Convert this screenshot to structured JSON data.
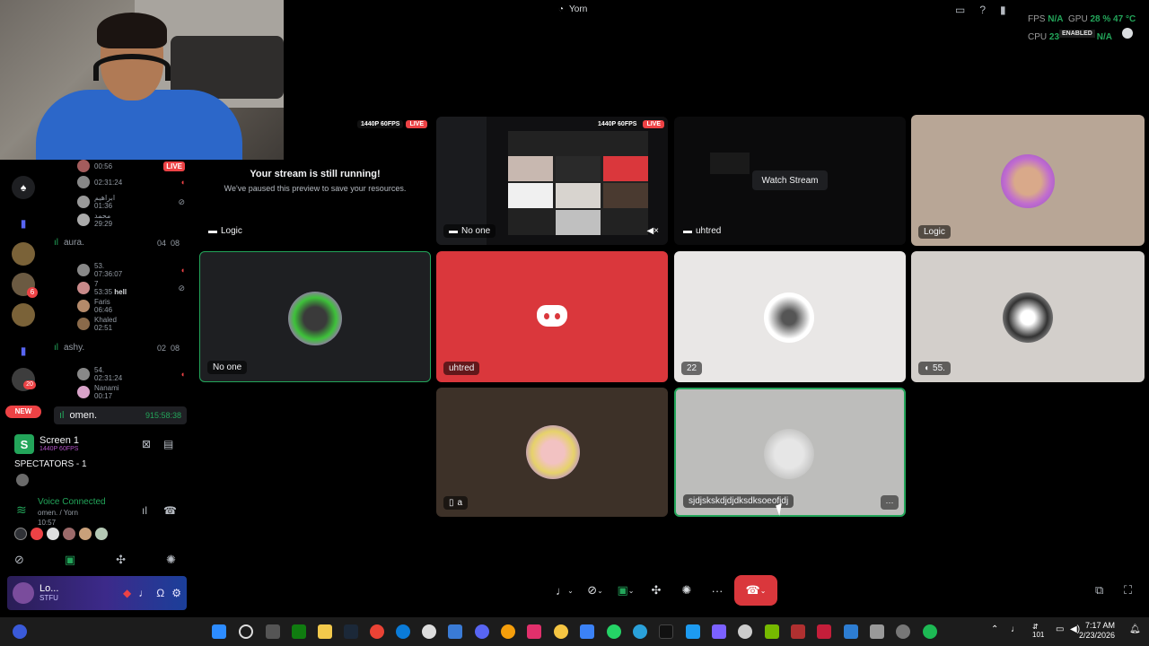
{
  "window": {
    "title": "Yorn"
  },
  "overlay_stats": {
    "fps_label": "FPS",
    "fps_value": "N/A",
    "gpu_label": "GPU",
    "gpu_value": "28 % 47 °C",
    "cpu_label": "CPU",
    "cpu_value": "23",
    "cpu_extra": "N/A",
    "enabled_tag": "ENABLED"
  },
  "sidebar": {
    "top_time": "00:56",
    "live_badge": "LIVE",
    "groups": [
      {
        "name": "",
        "users": [
          {
            "name": "",
            "time": "02:31:24"
          },
          {
            "name": "ابراهيم",
            "time": "01:36"
          },
          {
            "name": "محمد",
            "time": "29:29"
          }
        ]
      },
      {
        "name": "aura.",
        "count_a": "04",
        "count_b": "08",
        "users": [
          {
            "name": "53.",
            "time": "07:36:07"
          },
          {
            "name": "7",
            "time": "53:35",
            "extra": "hell"
          },
          {
            "name": "Faris",
            "time": "06:46"
          },
          {
            "name": "Khaled",
            "time": "02:51"
          }
        ]
      },
      {
        "name": "ashy.",
        "count_a": "02",
        "count_b": "08",
        "users": [
          {
            "name": "54.",
            "time": "02:31:24"
          },
          {
            "name": "Nanami",
            "time": "00:17"
          }
        ]
      }
    ],
    "active_user": {
      "name": "omen.",
      "time": "915:58:38"
    },
    "server_badges": {
      "b1": "6",
      "b2": "20",
      "new": "NEW"
    }
  },
  "screen_panel": {
    "title": "Screen 1",
    "subtitle": "1440P 60FPS",
    "spectators": "SPECTATORS - 1",
    "voice_connected": "Voice Connected",
    "voice_channel": "omen. / Yorn",
    "voice_time": "10:57"
  },
  "user_bar": {
    "name": "Lo...",
    "status": "STFU"
  },
  "stream_badges": {
    "quality": "1440P 60FPS",
    "live": "LIVE"
  },
  "paused": {
    "title": "Your stream is still running!",
    "subtitle": "We've paused this preview to save your resources."
  },
  "tiles": {
    "logic_stream": "Logic",
    "noone_stream": "No one",
    "uhtred_stream": "uhtred",
    "watch_stream": "Watch Stream",
    "logic_cam": "Logic",
    "noone": "No one",
    "uhtred": "uhtred",
    "t22": "22",
    "t55": "55.",
    "a": "a",
    "long": "sjdjskskdjdjdksdksoeofjdj"
  },
  "controls": {
    "more": "···"
  },
  "taskbar": {
    "time": "7:17 AM",
    "date": "2/23/2026",
    "lang": "101"
  },
  "colors": {
    "accent_green": "#23a55a",
    "danger": "#da373c",
    "discord": "#da373c"
  }
}
